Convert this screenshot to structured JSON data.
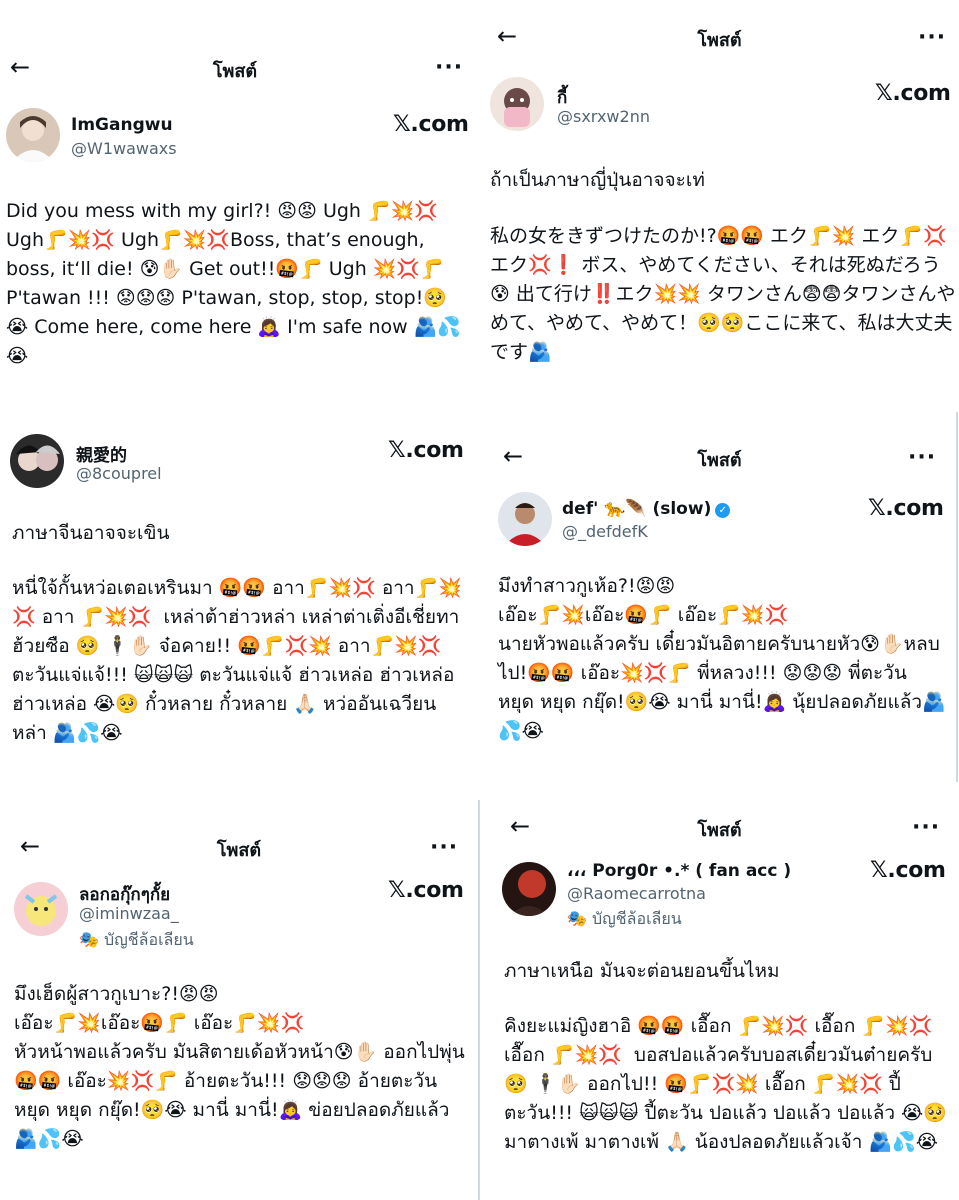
{
  "common": {
    "post_title": "โพสต์",
    "back_icon": "←",
    "more_icon": "···",
    "x_brand": "𝕏.com"
  },
  "posts": [
    {
      "name": "ImGangwu",
      "handle": "@W1wawaxs",
      "text": "Did you mess with my girl?! 😡😡 Ugh 🦵💥💢 Ugh🦵💥💢 Ugh🦵💥💢Boss, that’s enough, boss, it‘ll die! 😰✋🏻 Get out!!🤬🦵 Ugh 💥💢🦵 P'tawan !!! 😟😟😟 P'tawan, stop, stop, stop!🥺😭 Come here, come here 🙇‍♀️ I'm safe now 🫂💦😭"
    },
    {
      "name": "กี้",
      "handle": "@sxrxw2nn",
      "line1": "ถ้าเป็นภาษาญี่ปุ่นอาจจะเท่",
      "text": "私の女をきずつけたのか!?🤬🤬 エク🦵💥 エク🦵💢 エク💢❗️ ボス、やめてください、それは死ぬだろう😰 出て行け‼️エク💥💥 タワンさん😨😨タワンさんやめて、やめて、やめて！🥺🥺ここに来て、私は大丈夫です🫂"
    },
    {
      "name": "親愛的",
      "handle": "@8couprel",
      "line1": "ภาษาจีนอาจจะเขิน",
      "text": "หนี่ใจ้กั้นหว่อเตอเหรินมา 🤬🤬 อาา🦵💥💢 อาา🦵💥💢 อาา 🦵💥💢  เหล่าต้าฮ่าวหล่า เหล่าต่าเติ่งอีเชี่ยทาฮ้วยซือ 🥺 🕴✋🏻 จ๋อคาย!! 🤬🦵💢💥 อาา🦵💥💢 ตะวันแจ่แจ้!!! 🙀🙀🙀 ตะวันแจ่แจ้ ฮ่าวเหล่อ ฮ่าวเหล่อ ฮ่าวเหล่อ 😭🥺 กั๋วหลาย กั๋วหลาย 🙏🏻 หว่ออันเฉวียนหล่า 🫂💦😭"
    },
    {
      "name": "def' 🐆🪶 (slow)",
      "handle": "@_defdefK",
      "text": "มึงทำสาวกูเห้อ?!😡😡\nเอ๊อะ🦵💥เอ๊อะ🤬🦵 เอ๊อะ🦵💥💢\nนายหัวพอแล้วครับ เดี๋ยวมันอิตายครับนายหัว😰✋🏻หลบไป!🤬🤬 เอ๊อะ💥💢🦵 พี่หลวง!!! 😟😟😟 พี่ตะวัน หยุด หยุด กยุ๊ด!🥺😭 มานี่ มานี่!🙇‍♀️ นุ้ยปลอดภัยแล้ว🫂💦😭"
    },
    {
      "name": "ลอกอกุ๊กๆกั้ย",
      "handle": "@iminwzaa_",
      "parody_icon": "🎭",
      "parody": "บัญชีล้อเลียน",
      "text": "มึงเฮ็ดผู้สาวกูเบาะ?!😡😡\nเอ๊อะ🦵💥เอ๊อะ🤬🦵 เอ๊อะ🦵💥💢\nหัวหน้าพอแล้วครับ มันสิตายเด้อหัวหน้า😰✋🏻 ออกไปพุ่น🤬🤬 เอ๊อะ💥💢🦵 อ้ายตะวัน!!! 😟😟😟 อ้ายตะวัน หยุด หยุด กยุ๊ด!🥺😭 มานี่ มานี่!🙇‍♀️ ข่อยปลอดภัยแล้ว🫂💦😭"
    },
    {
      "name": "،،، Porg0r •.* ( fan acc )",
      "handle": "@Raomecarrotna",
      "parody_icon": "🎭",
      "parody": "บัญชีล้อเลียน",
      "line1": "ภาษาเหนือ มันจะต่อนยอนขึ้นไหม",
      "text": "คิงยะแม่ญิงฮาอิ 🤬🤬 เอื๊อก 🦵💥💢 เอื๊อก 🦵💥💢 เอื๊อก 🦵💥💢  บอสปอแล้วครับบอสเดี๋ยวมันต๋ายครับ 🥺 🕴✋🏻 ออกไป!! 🤬🦵💢💥 เอื๊อก 🦵💥💢 ปี้ตะวัน!!! 🙀🙀🙀 ปี้ตะวัน ปอแล้ว ปอแล้ว ปอแล้ว 😭🥺 มาตางเพ้ มาตางเพ้ 🙏🏻 น้องปลอดภัยแล้วเจ้า 🫂💦😭"
    }
  ]
}
